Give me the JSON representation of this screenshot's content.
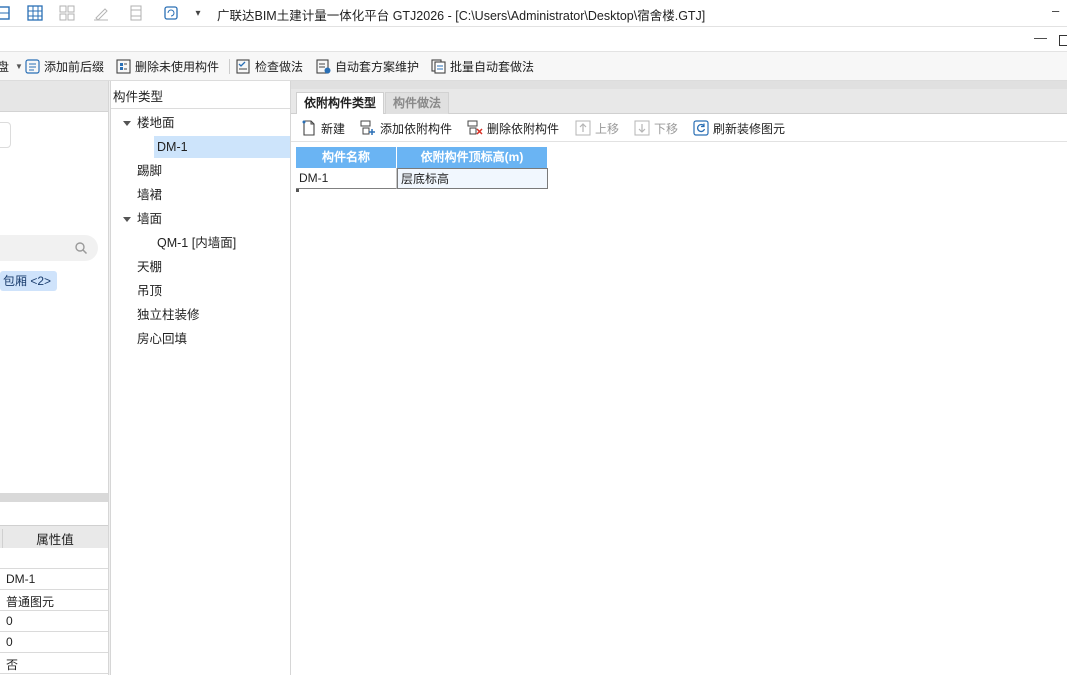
{
  "window": {
    "title": "广联达BIM土建计量一体化平台 GTJ2026 - [C:\\Users\\Administrator\\Desktop\\宿舍楼.GTJ]",
    "minimize_glyph": "–",
    "dropdown_glyph": "▾"
  },
  "secondary_bar": {
    "minimize_glyph": "—"
  },
  "toolbar": {
    "partial_label": "盘",
    "add_prefix_suffix": "添加前后缀",
    "delete_unused": "删除未使用构件",
    "check_method": "检查做法",
    "auto_scheme": "自动套方案维护",
    "batch_auto": "批量自动套做法"
  },
  "left_panel": {
    "tag": "包厢 <2>",
    "property_header": "属性值",
    "property_values": [
      "",
      "DM-1",
      "普通图元",
      "0",
      "0",
      "否"
    ]
  },
  "component_tree": {
    "header": "构件类型",
    "items": [
      {
        "label": "楼地面"
      },
      {
        "label": "DM-1"
      },
      {
        "label": "踢脚"
      },
      {
        "label": "墙裙"
      },
      {
        "label": "墙面"
      },
      {
        "label": "QM-1 [内墙面]"
      },
      {
        "label": "天棚"
      },
      {
        "label": "吊顶"
      },
      {
        "label": "独立柱装修"
      },
      {
        "label": "房心回填"
      }
    ]
  },
  "right_panel": {
    "tabs": [
      {
        "label": "依附构件类型"
      },
      {
        "label": "构件做法"
      }
    ],
    "toolbar": {
      "new": "新建",
      "add_attached": "添加依附构件",
      "delete_attached": "删除依附构件",
      "move_up": "上移",
      "move_down": "下移",
      "refresh": "刷新装修图元"
    },
    "grid": {
      "columns": [
        "构件名称",
        "依附构件顶标高(m)"
      ],
      "rows": [
        [
          "DM-1",
          "层底标高"
        ]
      ]
    }
  },
  "colors": {
    "grid_header": "#6ab4f3",
    "selection": "#cde4fb",
    "tag_bg": "#cfe3fb",
    "icon_blue": "#2a6fb5"
  }
}
